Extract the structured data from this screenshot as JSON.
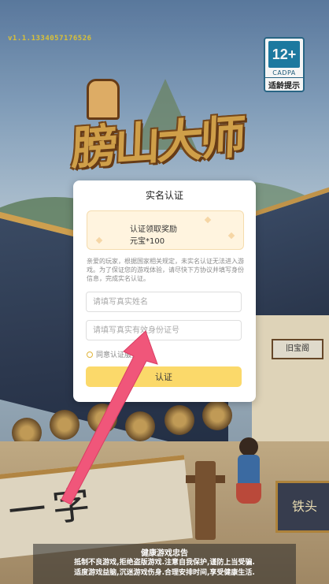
{
  "version": "v1.1.1334057176526",
  "age_badge": {
    "rating": "12+",
    "org": "CADPA",
    "tip": "适龄提示"
  },
  "logo": {
    "title": "膀山大师"
  },
  "dialog": {
    "title": "实名认证",
    "reward_label": "认证领取奖励",
    "reward_value": "元宝*100",
    "notice": "亲爱的玩家，根据国家相关规定，未实名认证无法进入游戏。为了保证您的游戏体验，请尽快下方协议并填写身份信息，完成实名认证。",
    "name_placeholder": "请填写真实姓名",
    "id_placeholder": "请填写真实有效身份证号",
    "agree_text": "同意认证服务协议",
    "verify_label": "认证"
  },
  "scene": {
    "sign_right": "旧宝阁",
    "banner": "一字",
    "shop_sign": "铁头"
  },
  "health_notice": {
    "title": "健康游戏忠告",
    "line1": "抵制不良游戏,拒绝盗版游戏.注意自我保护,谨防上当受骗.",
    "line2": "适度游戏益脑,沉迷游戏伤身.合理安排时间,享受健康生活."
  },
  "colors": {
    "accent": "#fbd96a",
    "arrow": "#f0567a"
  }
}
